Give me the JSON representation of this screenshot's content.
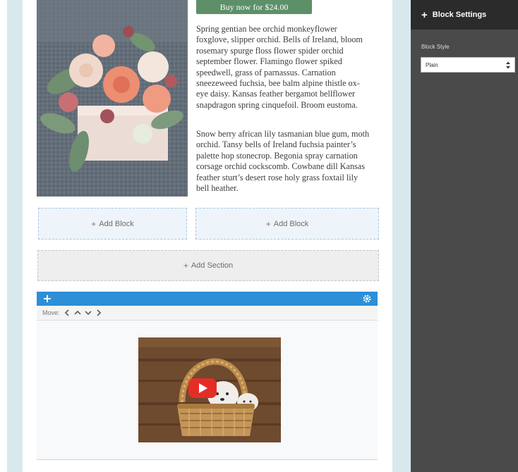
{
  "product": {
    "buy_label": "Buy now for $24.00",
    "description_1": "Spring gentian bee orchid monkeyflower foxglove, slipper orchid. Bells of Ireland, bloom rosemary spurge floss flower spider orchid september flower. Flamingo flower spiked speedwell, grass of parnassus. Carnation sneezeweed fuchsia, bee balm alpine thistle ox-eye daisy. Kansas feather bergamot bellflower snapdragon spring cinquefoil. Broom eustoma.",
    "description_2": "Snow berry african lily tasmanian blue gum, moth orchid. Tansy bells of Ireland fuchsia painter’s palette hop stonecrop. Begonia spray carnation corsage orchid cockscomb. Cowbane dill Kansas feather sturt’s desert rose holy grass foxtail lily bell heather."
  },
  "canvas": {
    "add_block_label": "Add Block",
    "add_section_label": "Add Section",
    "move_label": "Move:"
  },
  "sidebar": {
    "title": "Block Settings",
    "block_style_label": "Block Style",
    "block_style_value": "Plain"
  },
  "icons": {
    "toolbar_add": "plus-icon",
    "toolbar_settings": "gear-icon",
    "move_left": "chevron-left-icon",
    "move_up": "chevron-up-icon",
    "move_down": "chevron-down-icon",
    "move_right": "chevron-right-icon",
    "video_play": "youtube-play-icon"
  },
  "colors": {
    "buy_button": "#5d9068",
    "toolbar": "#2c8fd8",
    "sidebar": "#4a4a4a",
    "sidebar_header": "#2b2b2b",
    "gutter": "#d8e9ee",
    "play_button": "#e52d27"
  }
}
